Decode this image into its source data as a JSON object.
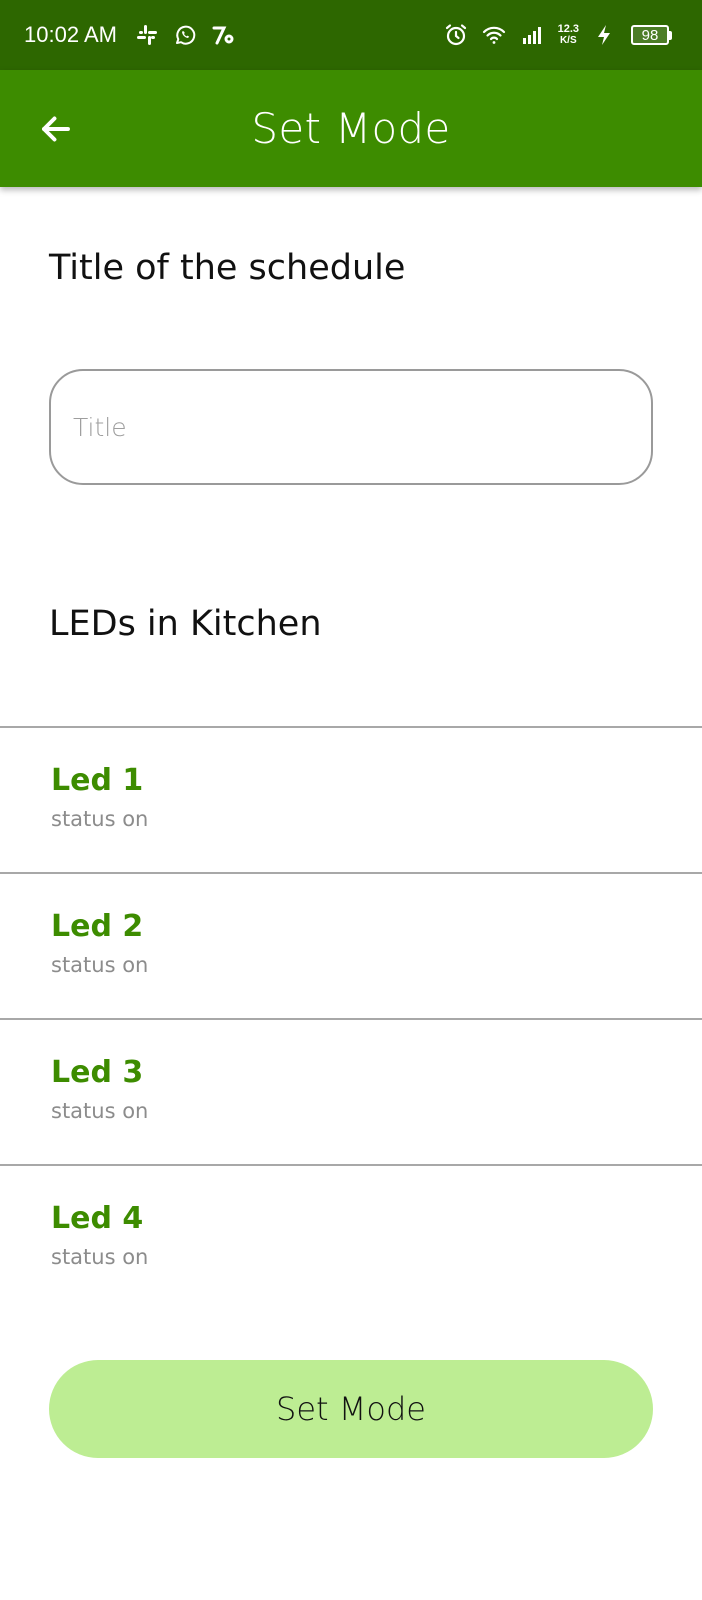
{
  "status_bar": {
    "time": "10:02 AM",
    "net_speed_value": "12.3",
    "net_speed_unit": "K/S",
    "battery_level": "98",
    "left_icons": [
      "slack-icon",
      "whatsapp-icon",
      "app-notification-icon"
    ],
    "right_icons": [
      "alarm-icon",
      "wifi-icon",
      "signal-icon",
      "charging-icon"
    ]
  },
  "app_bar": {
    "title": "Set Mode",
    "back_icon": "arrow-left-icon"
  },
  "form": {
    "schedule_heading": "Title of the schedule",
    "title_input": {
      "value": "",
      "placeholder": "Title"
    },
    "leds_heading": "LEDs in Kitchen"
  },
  "leds": [
    {
      "name": "Led 1",
      "status": "status on"
    },
    {
      "name": "Led 2",
      "status": "status on"
    },
    {
      "name": "Led 3",
      "status": "status on"
    },
    {
      "name": "Led 4",
      "status": "status on"
    }
  ],
  "actions": {
    "set_mode_label": "Set Mode"
  },
  "colors": {
    "status_bar": "#2d6700",
    "app_bar": "#3d8c00",
    "accent_text": "#3d8c00",
    "button_bg": "#bded93"
  }
}
